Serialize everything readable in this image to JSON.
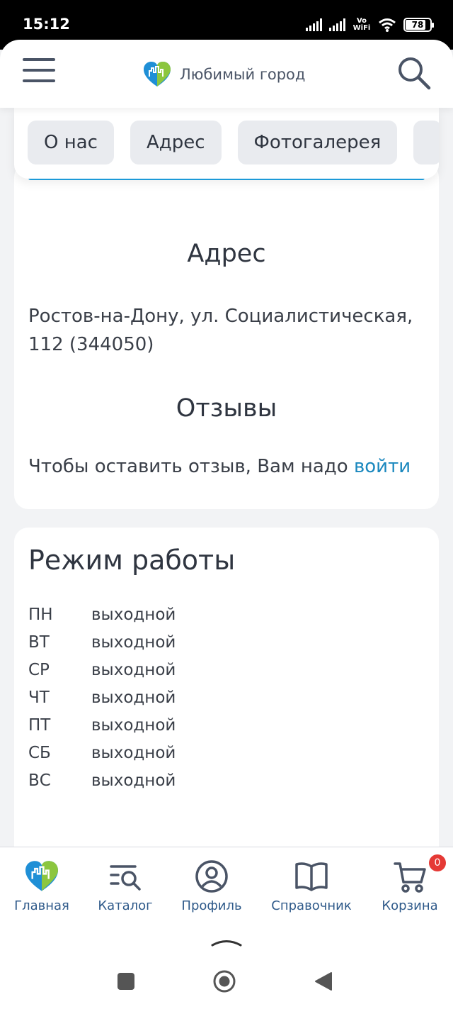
{
  "status_bar": {
    "time": "15:12",
    "network": "Vo WiFi",
    "battery": "78"
  },
  "header": {
    "logo_text": "Любимый город"
  },
  "tabs": [
    "О нас",
    "Адрес",
    "Фотогалерея"
  ],
  "address_section": {
    "title": "Адрес",
    "text": "Ростов-на-Дону, ул. Социалистическая, 112 (344050)"
  },
  "reviews_section": {
    "title": "Отзывы",
    "text": "Чтобы оставить отзыв, Вам надо ",
    "login_link": "войти"
  },
  "hours": {
    "title": "Режим работы",
    "rows": [
      {
        "day": "ПН",
        "value": "выходной"
      },
      {
        "day": "ВТ",
        "value": "выходной"
      },
      {
        "day": "СР",
        "value": "выходной"
      },
      {
        "day": "ЧТ",
        "value": "выходной"
      },
      {
        "day": "ПТ",
        "value": "выходной"
      },
      {
        "day": "СБ",
        "value": "выходной"
      },
      {
        "day": "ВС",
        "value": "выходной"
      }
    ]
  },
  "bottom_nav": {
    "home": "Главная",
    "catalog": "Каталог",
    "profile": "Профиль",
    "directory": "Справочник",
    "cart": "Корзина",
    "cart_count": "0"
  },
  "colors": {
    "accent": "#1ea3e4",
    "link": "#1b88be",
    "badge": "#e53935",
    "nav_label": "#2f5a8a"
  }
}
